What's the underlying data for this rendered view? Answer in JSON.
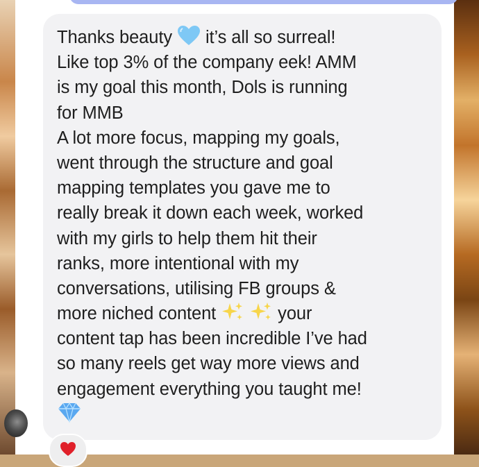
{
  "message": {
    "lines": [
      "Thanks beauty",
      "it’s all so surreal!",
      "Like top 3% of the company eek! AMM",
      "is my goal this month, Dols is running",
      "for MMB",
      "A lot more focus, mapping my goals,",
      "went through the structure and goal",
      "mapping templates you gave me to",
      "really break it down each week, worked",
      "with my girls to help them hit their",
      "ranks, more intentional with my",
      "conversations, utilising FB groups &",
      "more niched content",
      "your",
      "content tap has been incredible I’ve had",
      "so many reels get way more views and",
      "engagement  everything you taught me!"
    ]
  },
  "icons": {
    "heart_color": "#7ec8f5",
    "sparkle_color": "#f7d54a",
    "diamond_color": "#5aa8f0",
    "reaction_color": "#e0202a"
  },
  "colors": {
    "bubble_bg": "#f2f2f4",
    "top_bubble": "#a8b6f2",
    "text": "#1e1e1e"
  }
}
